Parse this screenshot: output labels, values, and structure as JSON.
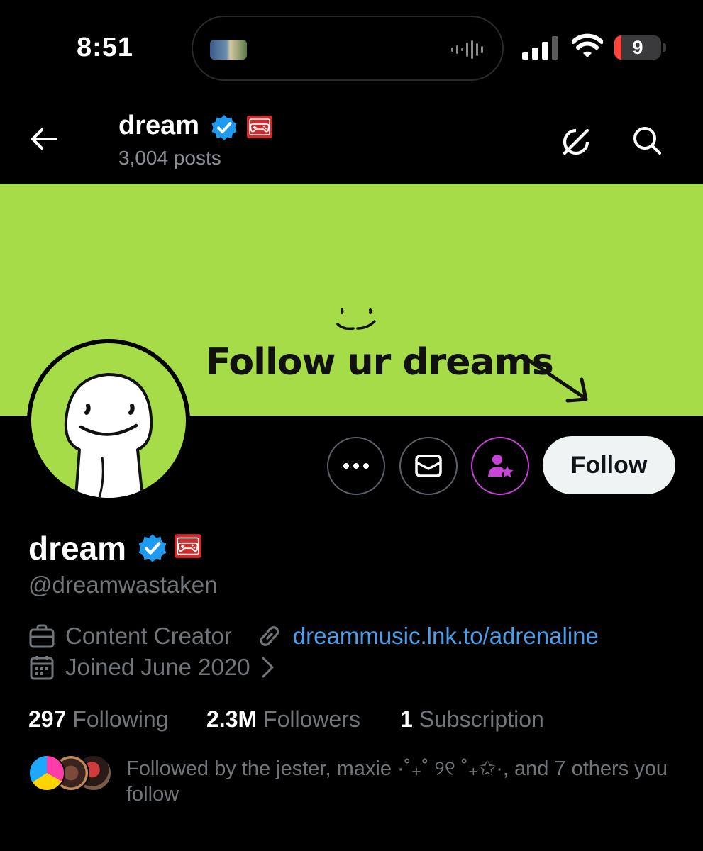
{
  "status_bar": {
    "time": "8:51",
    "battery": "9",
    "icons": [
      "live-activity-thumbnail-icon",
      "audio-wave-icon",
      "cellular-signal-icon",
      "wifi-icon",
      "battery-icon"
    ]
  },
  "header": {
    "name": "dream",
    "posts": "3,004 posts",
    "icons": [
      "back-arrow-icon",
      "verified-badge-icon",
      "gaming-affiliate-badge-icon",
      "grok-icon",
      "search-icon"
    ]
  },
  "banner": {
    "text": "Follow ur dreams",
    "bg_color": "#a5dc48"
  },
  "actions": {
    "follow_label": "Follow",
    "icons": [
      "more-icon",
      "message-icon",
      "subscribe-icon"
    ],
    "subscribe_color": "#c644d6"
  },
  "profile": {
    "name": "dream",
    "handle": "@dreamwastaken",
    "category": "Content Creator",
    "link": "dreammusic.lnk.to/adrenaline",
    "joined": "Joined June 2020",
    "verified_color": "#1d9bf0",
    "link_color": "#4a9eea"
  },
  "stats": {
    "following_count": "297",
    "following_label": "Following",
    "followers_count": "2.3M",
    "followers_label": "Followers",
    "subscriptions_count": "1",
    "subscriptions_label": "Subscription"
  },
  "followed_by": {
    "text": "Followed by the jester, maxie ·˚₊˚ ୨୧ ˚₊✩·, and 7 others you follow"
  }
}
